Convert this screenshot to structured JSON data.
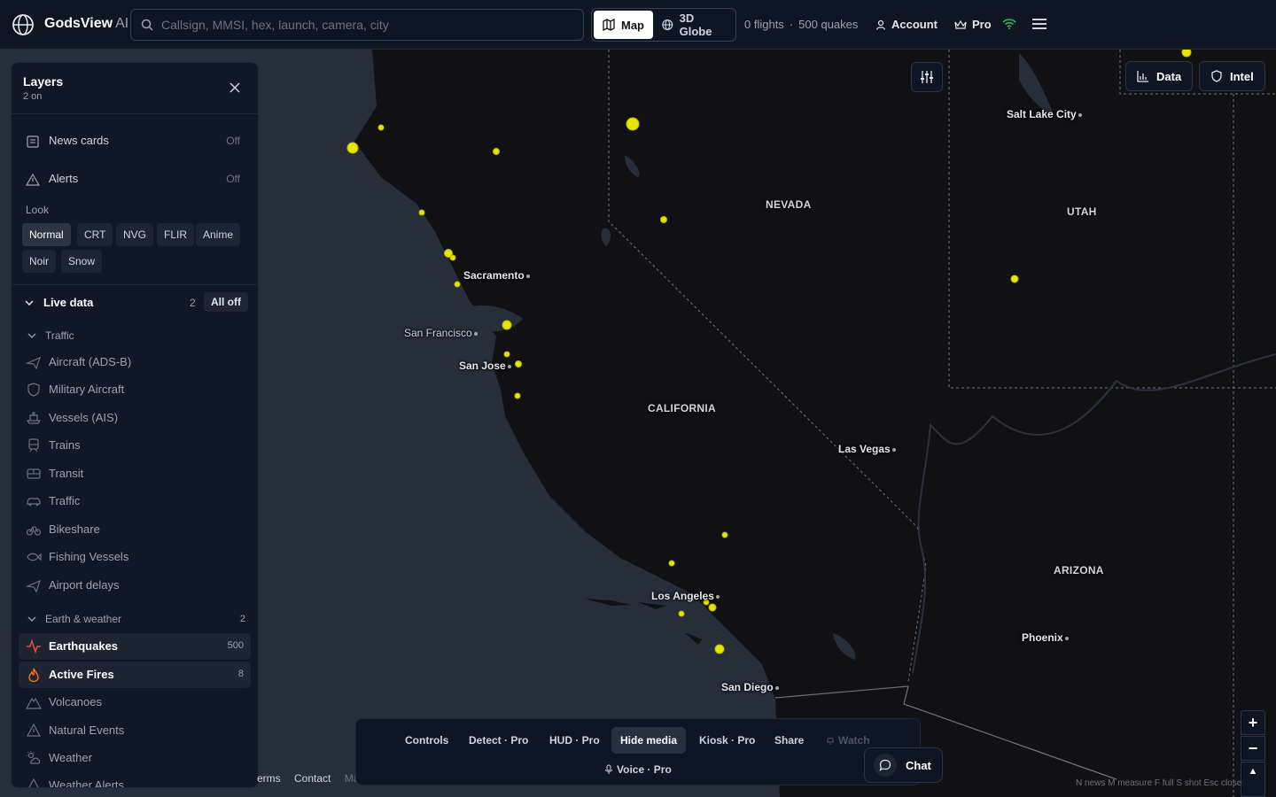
{
  "app": {
    "brand": "GodsView",
    "brand_suffix": "AI"
  },
  "search": {
    "placeholder": "Callsign, MMSI, hex, launch, camera, city"
  },
  "view": {
    "map_label": "Map",
    "globe_label": "3D Globe",
    "active": "Map"
  },
  "stats": {
    "flights": "0 flights",
    "quakes": "500 quakes"
  },
  "account": {
    "account_label": "Account",
    "pro_label": "Pro"
  },
  "layers": {
    "title": "Layers",
    "subtitle": "2 on",
    "news_cards": {
      "label": "News cards",
      "value": "Off"
    },
    "alerts": {
      "label": "Alerts",
      "value": "Off"
    },
    "look_label": "Look",
    "looks": [
      "Normal",
      "CRT",
      "NVG",
      "FLIR",
      "Anime",
      "Noir",
      "Snow"
    ],
    "active_look": "Normal",
    "live_data": {
      "label": "Live data",
      "count": "2",
      "all_off": "All off"
    },
    "traffic_section": {
      "label": "Traffic"
    },
    "traffic_items": [
      "Aircraft (ADS-B)",
      "Military Aircraft",
      "Vessels (AIS)",
      "Trains",
      "Transit",
      "Traffic",
      "Bikeshare",
      "Fishing Vessels",
      "Airport delays"
    ],
    "earth_section": {
      "label": "Earth & weather",
      "count": "2"
    },
    "earth_items": [
      {
        "label": "Earthquakes",
        "value": "500",
        "on": true
      },
      {
        "label": "Active Fires",
        "value": "8",
        "on": true
      },
      {
        "label": "Volcanoes",
        "value": "",
        "on": false
      },
      {
        "label": "Natural Events",
        "value": "",
        "on": false
      },
      {
        "label": "Weather",
        "value": "",
        "on": false
      },
      {
        "label": "Weather Alerts",
        "value": "",
        "on": false
      }
    ]
  },
  "map": {
    "states": [
      "NEVADA",
      "UTAH",
      "CALIFORNIA",
      "ARIZONA"
    ],
    "cities": [
      "Salt Lake City",
      "Sacramento",
      "San Francisco",
      "San Jose",
      "Las Vegas",
      "Los Angeles",
      "Phoenix",
      "San Diego"
    ],
    "colors": {
      "quake": "#e6e600",
      "land": "#111113",
      "water": "#2a3240"
    }
  },
  "top_right": {
    "data_label": "Data",
    "intel_label": "Intel"
  },
  "toolbar": {
    "controls": "Controls",
    "detect": "Detect · Pro",
    "hud": "HUD · Pro",
    "hide_media": "Hide media",
    "kiosk": "Kiosk · Pro",
    "share": "Share",
    "watch": "Watch",
    "voice": "Voice · Pro"
  },
  "chat": {
    "label": "Chat"
  },
  "footer": {
    "terms": "erms",
    "contact": "Contact",
    "more": "Ma"
  },
  "hotkeys": "N news   M measure   F full   S shot   Esc close"
}
